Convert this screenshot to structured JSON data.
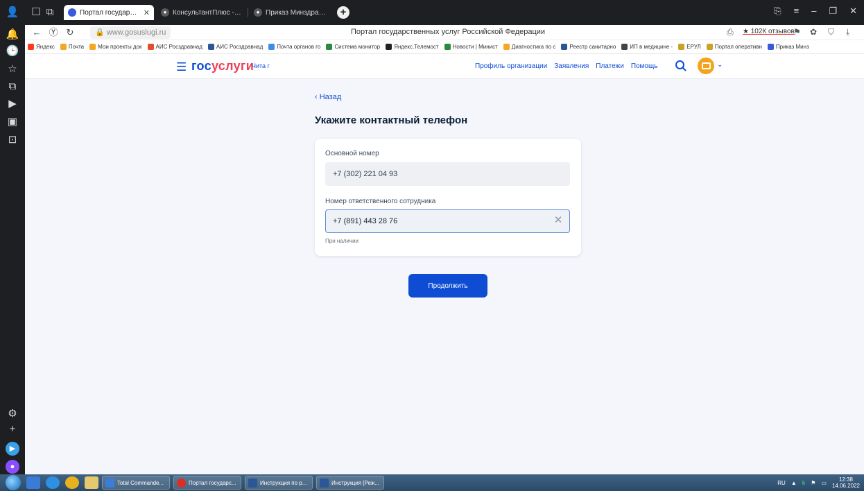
{
  "browser": {
    "tabs": [
      {
        "label": "Портал государственны",
        "active": true,
        "favicon_color": "#3a5bd9"
      },
      {
        "label": "КонсультантПлюс - Поиск",
        "active": false,
        "favicon_color": "#5a5a5a"
      },
      {
        "label": "Приказ Минздрава Россон",
        "active": false,
        "favicon_color": "#5a5a5a"
      }
    ],
    "new_tab_label": "+",
    "url": "www.gosuslugi.ru",
    "page_title": "Портал государственных услуг Российской Федерации",
    "reviews_label": "★ 102К отзывов",
    "bookmarks": [
      {
        "label": "Яндекс",
        "color": "#ff3b1f"
      },
      {
        "label": "Почта",
        "color": "#f5a623"
      },
      {
        "label": "Мои проекты док",
        "color": "#f5a623"
      },
      {
        "label": "АИС Росздравнад",
        "color": "#e34d2b"
      },
      {
        "label": "АИС Росздравнад",
        "color": "#2b5797"
      },
      {
        "label": "Почта органов го",
        "color": "#3a8ee6"
      },
      {
        "label": "Система монитор",
        "color": "#2b8a3e"
      },
      {
        "label": "Яндекс.Телемост",
        "color": "#222222"
      },
      {
        "label": "Новости | Минист",
        "color": "#2b8a3e"
      },
      {
        "label": "Диагностика по с",
        "color": "#f5a623"
      },
      {
        "label": "Реестр санитарно",
        "color": "#2b5797"
      },
      {
        "label": "ИП в медицине -",
        "color": "#444444"
      },
      {
        "label": "ЕРУЛ",
        "color": "#c9a227"
      },
      {
        "label": "Портал оперативн",
        "color": "#c9a227"
      },
      {
        "label": "Приказ Минз",
        "color": "#3a5bd9"
      }
    ]
  },
  "site": {
    "logo_part1": "гос",
    "logo_part2": "услуги",
    "region": "Чита г",
    "nav": [
      {
        "label": "Профиль организации"
      },
      {
        "label": "Заявления"
      },
      {
        "label": "Платежи"
      },
      {
        "label": "Помощь"
      }
    ]
  },
  "form": {
    "back_label": "‹ Назад",
    "heading": "Укажите контактный телефон",
    "main_phone_label": "Основной номер",
    "main_phone_value": "+7 (302) 221 04 93",
    "employee_phone_label": "Номер ответственного сотрудника",
    "employee_phone_value": "+7 (891) 443 28 76",
    "hint": "При наличии",
    "continue_label": "Продолжить"
  },
  "taskbar": {
    "items": [
      {
        "label": "Total Commande...",
        "color": "#3b7dd8"
      },
      {
        "label": "Портал государс...",
        "color": "#d93025"
      },
      {
        "label": "Инструкция по р...",
        "color": "#2b5797"
      },
      {
        "label": "Инструкция [Реж...",
        "color": "#2b5797"
      }
    ],
    "lang": "RU",
    "time": "12:38",
    "date": "14.06.2022"
  },
  "colors": {
    "accent": "#0d4cd3",
    "logo_red": "#ee3f58",
    "page_bg": "#f4f6fb"
  }
}
